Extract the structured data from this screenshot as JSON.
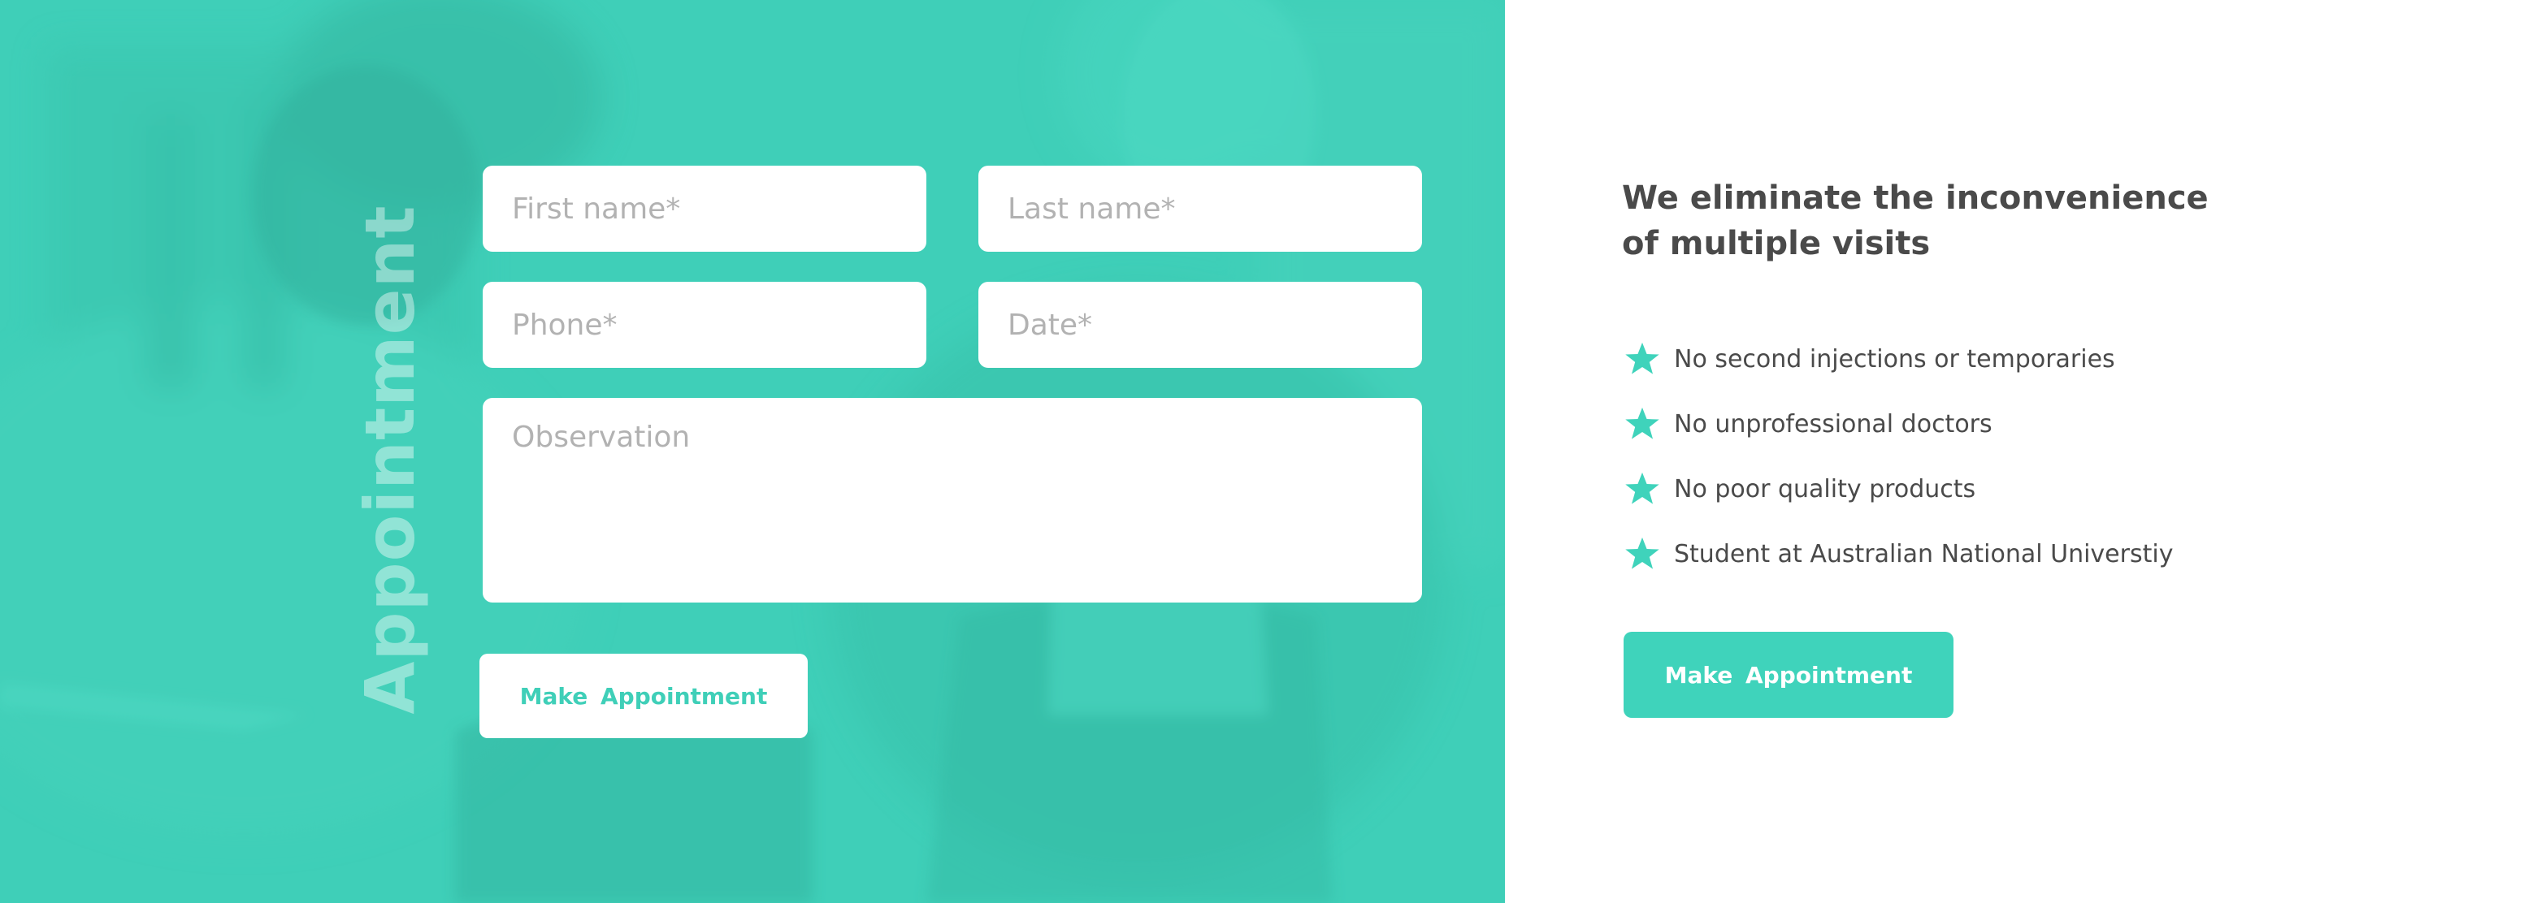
{
  "colors": {
    "accent": "#3fd3bb",
    "overlay": "#3fcfb8",
    "text_dark": "#4a4a4a",
    "placeholder": "#b2b2b2"
  },
  "appointment_form": {
    "title": "Appointment",
    "fields": {
      "first_name": {
        "placeholder": "First name*",
        "value": ""
      },
      "last_name": {
        "placeholder": "Last name*",
        "value": ""
      },
      "phone": {
        "placeholder": "Phone*",
        "value": ""
      },
      "date": {
        "placeholder": "Date*",
        "value": ""
      },
      "observation": {
        "placeholder": "Observation",
        "value": ""
      }
    },
    "submit_label": "Make  Appointment"
  },
  "info": {
    "headline": "We eliminate the inconvenience of multiple visits",
    "features": [
      {
        "icon": "star-icon",
        "text": "No second injections or temporaries"
      },
      {
        "icon": "star-icon",
        "text": "No unprofessional doctors"
      },
      {
        "icon": "star-icon",
        "text": "No poor quality products"
      },
      {
        "icon": "star-icon",
        "text": "Student at Australian National Universtiy"
      }
    ],
    "button_label": "Make  Appointment"
  }
}
